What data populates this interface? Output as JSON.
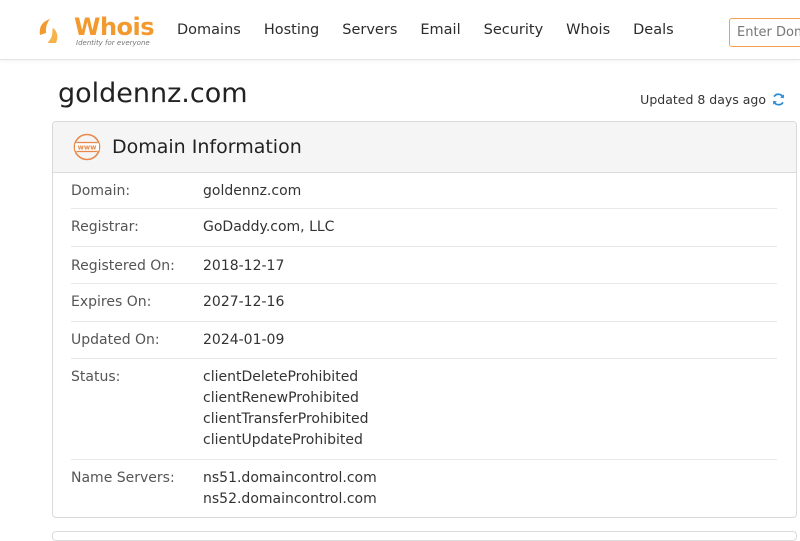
{
  "header": {
    "logo_text": "Whois",
    "logo_tagline": "Identity for everyone",
    "nav": [
      "Domains",
      "Hosting",
      "Servers",
      "Email",
      "Security",
      "Whois",
      "Deals"
    ],
    "search_placeholder": "Enter Domain or IP"
  },
  "page": {
    "title": "goldennz.com",
    "updated_text": "Updated 8 days ago"
  },
  "card": {
    "title": "Domain Information",
    "rows": [
      {
        "label": "Domain:",
        "values": [
          "goldennz.com"
        ]
      },
      {
        "label": "Registrar:",
        "values": [
          "GoDaddy.com, LLC"
        ]
      },
      {
        "label": "Registered On:",
        "values": [
          "2018-12-17"
        ]
      },
      {
        "label": "Expires On:",
        "values": [
          "2027-12-16"
        ]
      },
      {
        "label": "Updated On:",
        "values": [
          "2024-01-09"
        ]
      },
      {
        "label": "Status:",
        "values": [
          "clientDeleteProhibited",
          "clientRenewProhibited",
          "clientTransferProhibited",
          "clientUpdateProhibited"
        ]
      },
      {
        "label": "Name Servers:",
        "values": [
          "ns51.domaincontrol.com",
          "ns52.domaincontrol.com"
        ]
      }
    ]
  },
  "colors": {
    "brand_orange": "#f29a2e",
    "refresh_blue": "#2a8ad4"
  },
  "icons": {
    "logo": "whois-logo-mark-icon",
    "refresh": "refresh-icon",
    "card": "www-globe-icon"
  }
}
